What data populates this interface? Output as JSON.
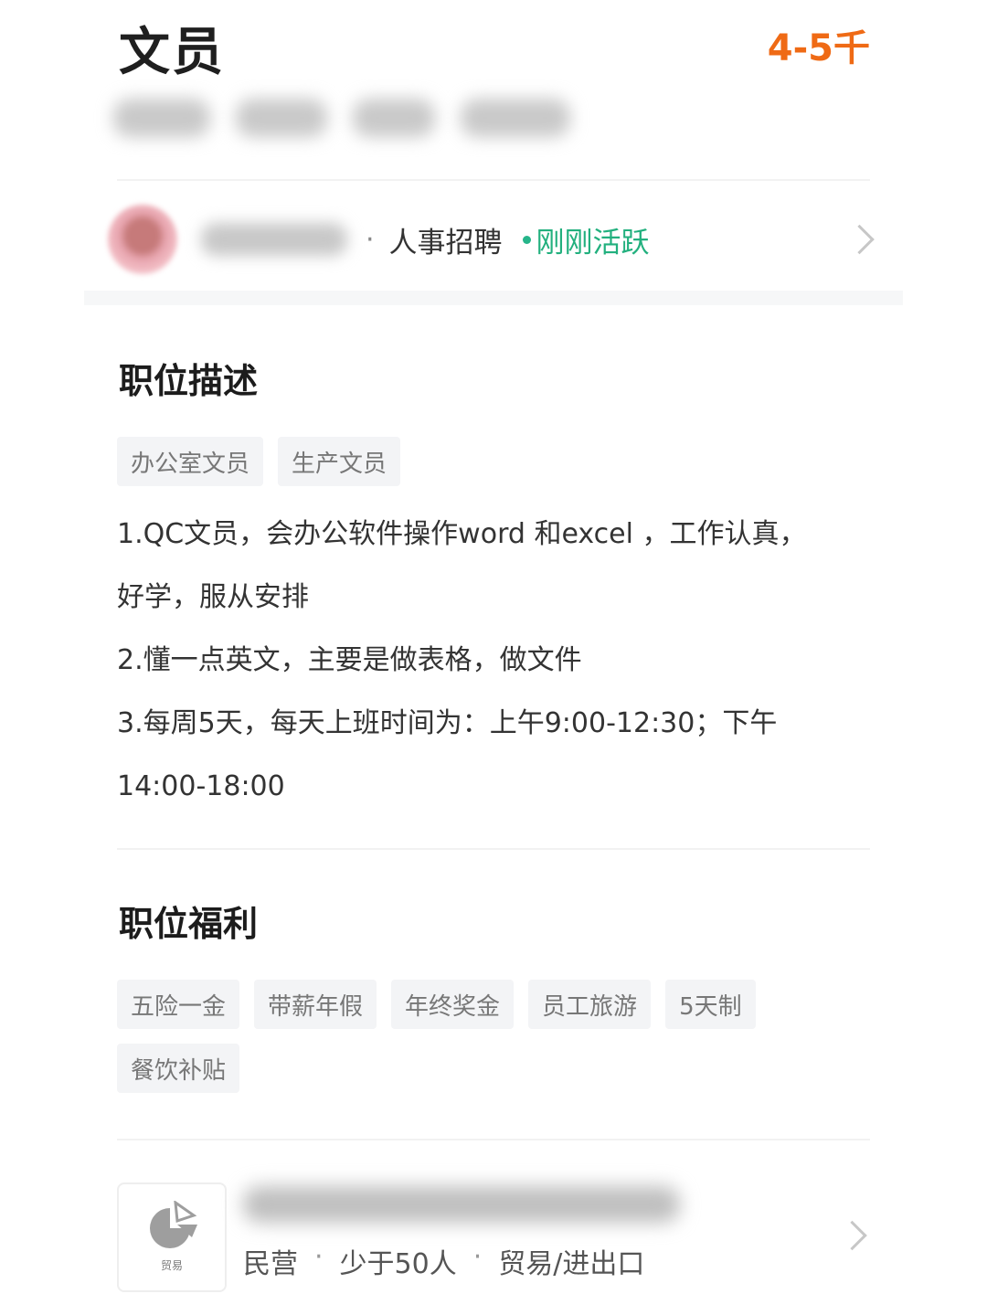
{
  "header": {
    "title": "文员",
    "salary": "4-5千"
  },
  "recruiter": {
    "separator": "·",
    "role": "人事招聘",
    "status": "刚刚活跃"
  },
  "description": {
    "title": "职位描述",
    "tags": [
      "办公室文员",
      "生产文员"
    ],
    "lines": [
      "1.QC文员，会办公软件操作word 和excel ，工作认真，",
      "好学，服从安排",
      "2.懂一点英文，主要是做表格，做文件",
      "3.每周5天，每天上班时间为：上午9:00-12:30；下午",
      "14:00-18:00"
    ]
  },
  "benefits": {
    "title": "职位福利",
    "tags": [
      "五险一金",
      "带薪年假",
      "年终奖金",
      "员工旅游",
      "5天制",
      "餐饮补贴"
    ]
  },
  "company": {
    "logo_label": "贸易",
    "ownership": "民营",
    "size": "少于50人",
    "industry": "贸易/进出口",
    "separator": "·"
  },
  "colors": {
    "salary": "#ef6a15",
    "active": "#22b07e"
  }
}
